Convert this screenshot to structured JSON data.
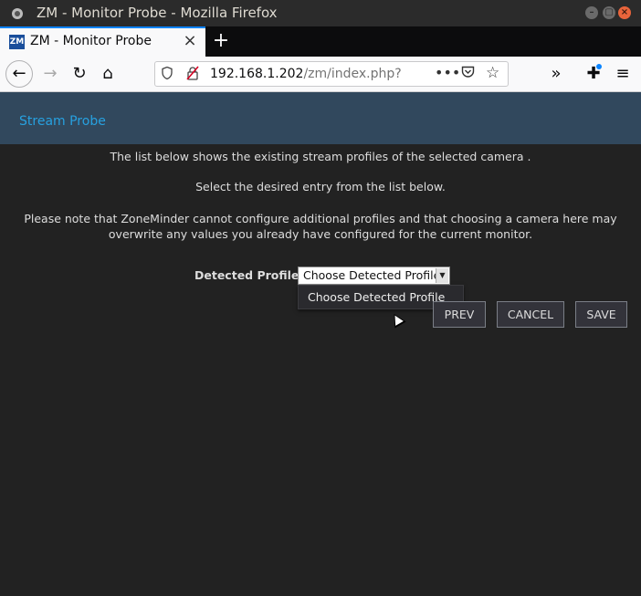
{
  "window": {
    "title": "ZM - Monitor Probe - Mozilla Firefox",
    "controls": {
      "minimize": "–",
      "maximize": "▢",
      "close": "×"
    }
  },
  "tabs": [
    {
      "favicon_text": "ZM",
      "label": "ZM - Monitor Probe",
      "close": "×"
    }
  ],
  "new_tab": "+",
  "navbar": {
    "back": "←",
    "forward": "→",
    "reload": "↻",
    "home": "⌂",
    "url_host": "192.168.1.202",
    "url_path": "/zm/index.php?",
    "more": "•••",
    "pocket": "♡",
    "star": "☆",
    "overflow": "»",
    "extensions": "✚",
    "menu": "≡"
  },
  "page": {
    "title": "Stream Probe",
    "para1": "The list below shows the existing stream profiles of the selected camera .",
    "para2": "Select the desired entry from the list below.",
    "para3": "Please note that ZoneMinder cannot configure additional profiles and that choosing a camera here may overwrite any values you already have configured for the current monitor.",
    "profiles_label": "Detected Profiles",
    "select_value": "Choose Detected Profile",
    "dropdown_options": [
      "Choose Detected Profile"
    ],
    "buttons": {
      "prev": "PREV",
      "cancel": "CANCEL",
      "save": "SAVE"
    }
  },
  "colors": {
    "header_bg": "#31485d",
    "accent_link": "#27a1e0",
    "page_bg": "#222222",
    "tab_highlight": "#0a84ff"
  }
}
